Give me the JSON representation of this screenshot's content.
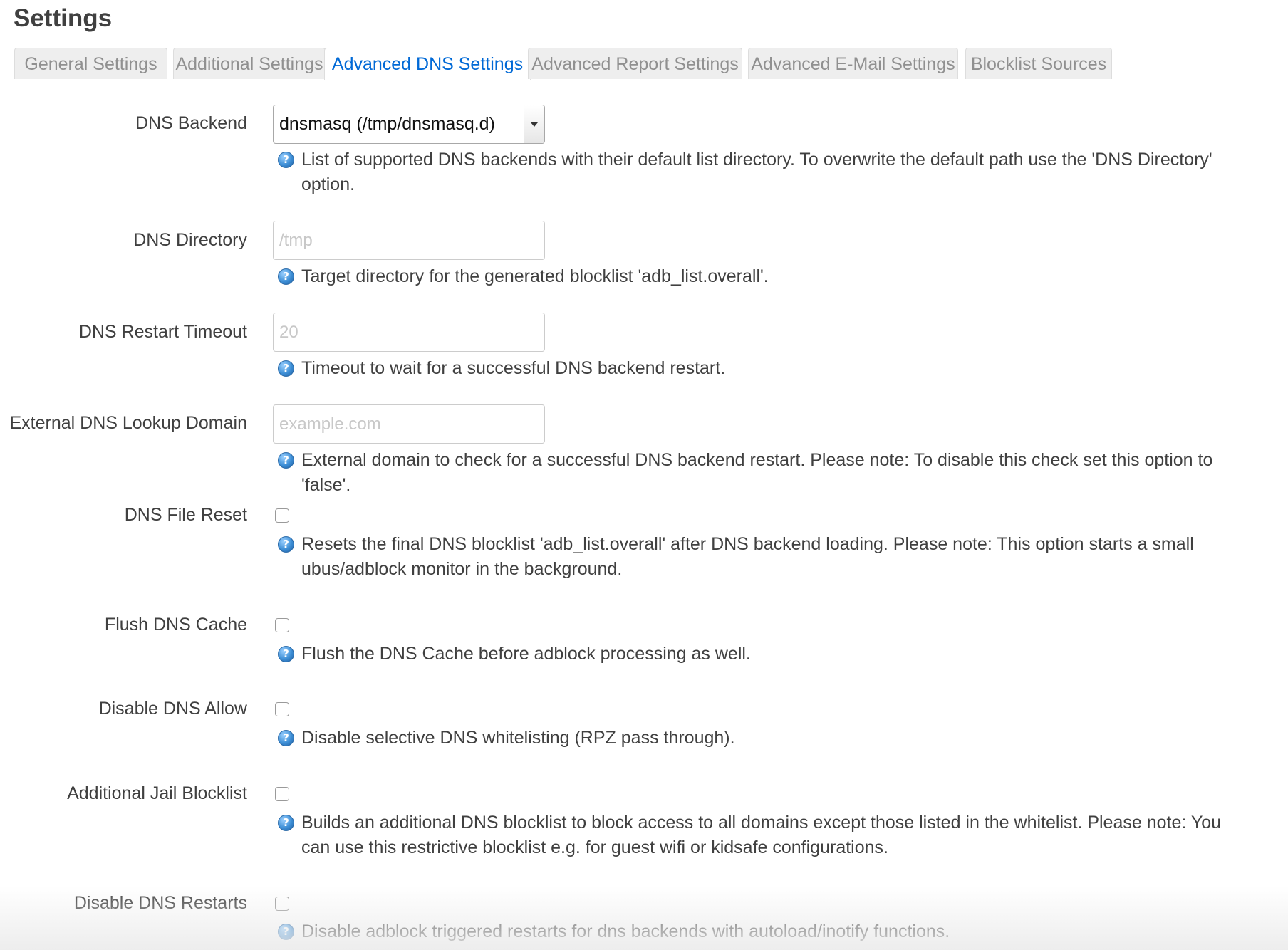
{
  "page": {
    "title": "Settings"
  },
  "tabs": [
    {
      "label": "General Settings",
      "active": false
    },
    {
      "label": "Additional Settings",
      "active": false
    },
    {
      "label": "Advanced DNS Settings",
      "active": true
    },
    {
      "label": "Advanced Report Settings",
      "active": false
    },
    {
      "label": "Advanced E-Mail Settings",
      "active": false
    },
    {
      "label": "Blocklist Sources",
      "active": false
    }
  ],
  "fields": {
    "dns_backend": {
      "label": "DNS Backend",
      "value": "dnsmasq (/tmp/dnsmasq.d)",
      "help": "List of supported DNS backends with their default list directory. To overwrite the default path use the 'DNS Directory' option."
    },
    "dns_directory": {
      "label": "DNS Directory",
      "value": "",
      "placeholder": "/tmp",
      "help": "Target directory for the generated blocklist 'adb_list.overall'."
    },
    "dns_restart_timeout": {
      "label": "DNS Restart Timeout",
      "value": "",
      "placeholder": "20",
      "help": "Timeout to wait for a successful DNS backend restart."
    },
    "external_dns_lookup_domain": {
      "label": "External DNS Lookup Domain",
      "value": "",
      "placeholder": "example.com",
      "help": "External domain to check for a successful DNS backend restart. Please note: To disable this check set this option to 'false'."
    },
    "dns_file_reset": {
      "label": "DNS File Reset",
      "checked": false,
      "help": "Resets the final DNS blocklist 'adb_list.overall' after DNS backend loading. Please note: This option starts a small ubus/adblock monitor in the background."
    },
    "flush_dns_cache": {
      "label": "Flush DNS Cache",
      "checked": false,
      "help": "Flush the DNS Cache before adblock processing as well."
    },
    "disable_dns_allow": {
      "label": "Disable DNS Allow",
      "checked": false,
      "help": "Disable selective DNS whitelisting (RPZ pass through)."
    },
    "additional_jail_blocklist": {
      "label": "Additional Jail Blocklist",
      "checked": false,
      "help": "Builds an additional DNS blocklist to block access to all domains except those listed in the whitelist. Please note: You can use this restrictive blocklist e.g. for guest wifi or kidsafe configurations."
    },
    "disable_dns_restarts": {
      "label": "Disable DNS Restarts",
      "checked": false,
      "help": "Disable adblock triggered restarts for dns backends with autoload/inotify functions."
    }
  },
  "icons": {
    "help": "help-icon",
    "help_glyph": "?",
    "dropdown": "chevron-down-icon"
  },
  "colors": {
    "active_tab": "#0069d6",
    "inactive_tab": "#909090",
    "help_icon": "#3e8fd6"
  }
}
